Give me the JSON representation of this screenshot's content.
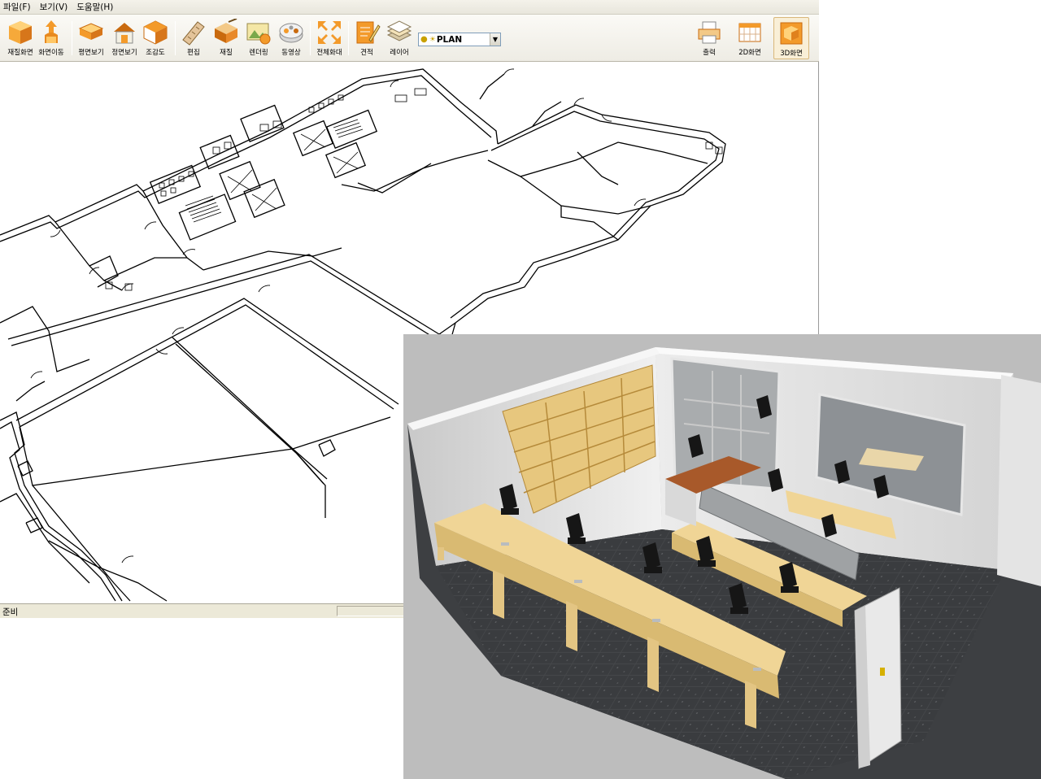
{
  "menu": {
    "items": [
      "파일(F)",
      "보기(V)",
      "도움말(H)"
    ]
  },
  "toolbar": {
    "tools": [
      {
        "label": "재질화면",
        "icon": "cube-icon"
      },
      {
        "label": "화면이동",
        "icon": "move-view-icon"
      },
      {
        "label": "평면보기",
        "icon": "plan-view-icon"
      },
      {
        "label": "정면보기",
        "icon": "front-view-icon"
      },
      {
        "label": "조감도",
        "icon": "bird-view-icon"
      },
      {
        "label": "편집",
        "icon": "edit-ruler-icon"
      },
      {
        "label": "재질",
        "icon": "material-icon"
      },
      {
        "label": "렌더링",
        "icon": "render-icon"
      },
      {
        "label": "동영상",
        "icon": "video-reel-icon"
      },
      {
        "label": "전체화대",
        "icon": "zoom-extents-icon"
      },
      {
        "label": "견적",
        "icon": "estimate-icon"
      },
      {
        "label": "레이어",
        "icon": "layer-icon"
      }
    ],
    "right_tools": [
      {
        "label": "출력",
        "icon": "print-icon"
      },
      {
        "label": "2D화면",
        "icon": "2d-view-icon"
      },
      {
        "label": "3D화면",
        "icon": "3d-view-icon"
      }
    ],
    "layer_select": {
      "value": "PLAN"
    }
  },
  "status": {
    "text": "준비"
  },
  "colors": {
    "accent": "#f39a2a",
    "accent_dark": "#c96a0e",
    "toolbar_bg": "#eeece4",
    "floor": "#3d3f42",
    "desk": "#f0d596"
  }
}
